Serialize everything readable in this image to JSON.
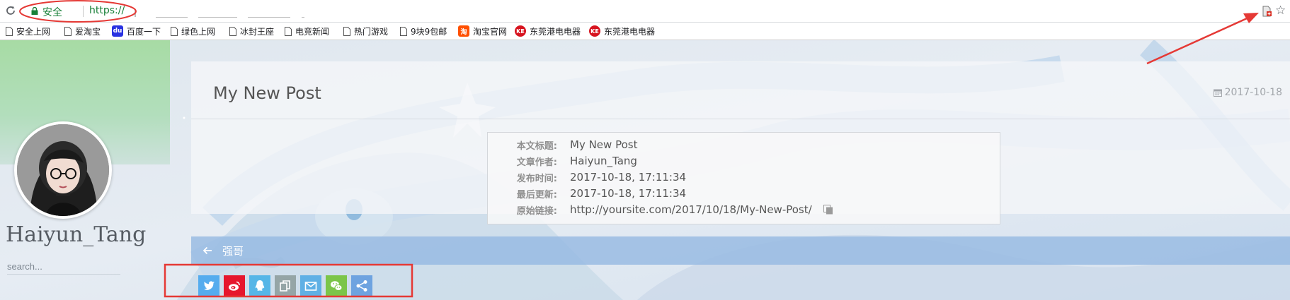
{
  "browser": {
    "secure_label": "安全",
    "url_text": "https://"
  },
  "bookmarks": [
    {
      "label": "安全上网",
      "icon": "page-icon"
    },
    {
      "label": "爱淘宝",
      "icon": "page-icon"
    },
    {
      "label": "百度一下",
      "icon": "baidu-icon"
    },
    {
      "label": "绿色上网",
      "icon": "page-icon"
    },
    {
      "label": "冰封王座",
      "icon": "page-icon"
    },
    {
      "label": "电竞新闻",
      "icon": "page-icon"
    },
    {
      "label": "热门游戏",
      "icon": "page-icon"
    },
    {
      "label": "9块9包邮",
      "icon": "page-icon"
    },
    {
      "label": "淘宝官网",
      "icon": "taobao-icon"
    },
    {
      "label": "东莞港电电器",
      "icon": "ke-icon"
    },
    {
      "label": "东莞港电电器",
      "icon": "ke-icon"
    }
  ],
  "sidebar": {
    "author_name": "Haiyun_Tang",
    "search_placeholder": "search..."
  },
  "post": {
    "title": "My New Post",
    "date": "2017-10-18"
  },
  "copyright": [
    {
      "label": "本文标题:",
      "value": "My New Post"
    },
    {
      "label": "文章作者:",
      "value": "Haiyun_Tang"
    },
    {
      "label": "发布时间:",
      "value": "2017-10-18, 17:11:34"
    },
    {
      "label": "最后更新:",
      "value": "2017-10-18, 17:11:34"
    },
    {
      "label": "原始链接:",
      "value": "http://yoursite.com/2017/10/18/My-New-Post/"
    }
  ],
  "prev_post": {
    "title": "强哥"
  },
  "share_buttons": [
    {
      "name": "twitter",
      "color": "#55acee"
    },
    {
      "name": "weibo",
      "color": "#e6162d"
    },
    {
      "name": "qq",
      "color": "#56b6e7"
    },
    {
      "name": "copy",
      "color": "#95a5a6"
    },
    {
      "name": "email",
      "color": "#5fb0e5"
    },
    {
      "name": "wechat",
      "color": "#7bc549"
    },
    {
      "name": "share",
      "color": "#6ea3e0"
    }
  ],
  "colors": {
    "annotation_red": "#e53935",
    "secure_green": "#188038",
    "nav_blue": "#96b9e2"
  }
}
